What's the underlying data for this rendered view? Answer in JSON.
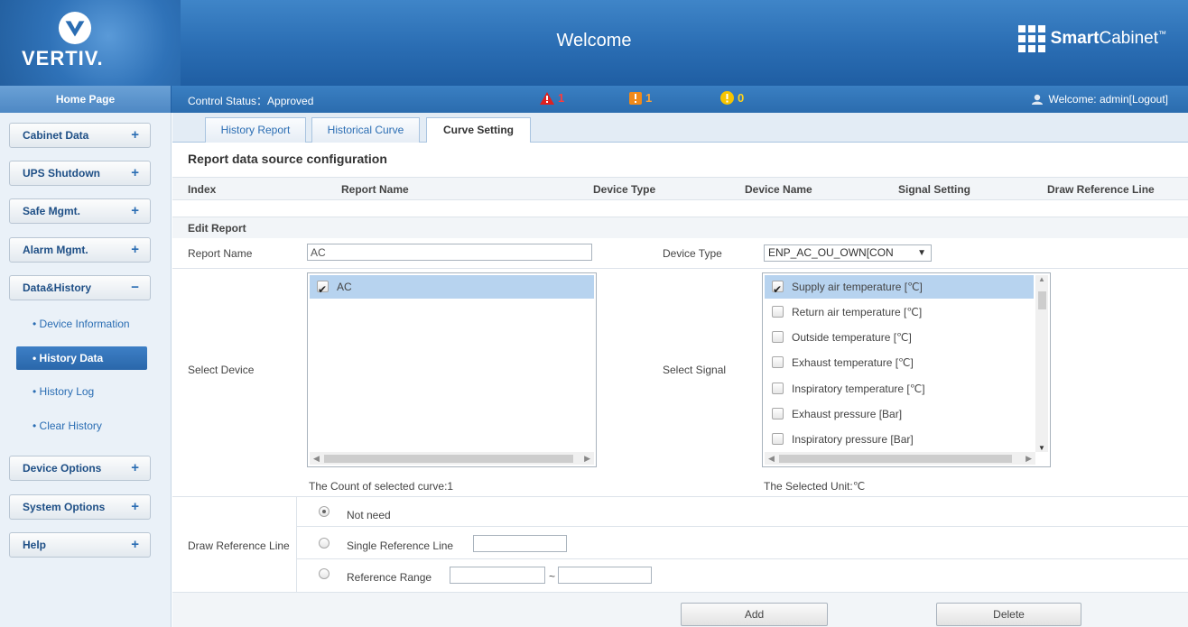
{
  "header": {
    "logo_text": "VERTIV.",
    "title": "Welcome",
    "brand_bold": "Smart",
    "brand_rest": "Cabinet",
    "brand_tm": "™"
  },
  "statusbar": {
    "home": "Home Page",
    "control_status": "Control Status：Approved",
    "alarms": [
      {
        "icon": "critical-alarm-icon",
        "count": "1",
        "color": "#e0201f"
      },
      {
        "icon": "major-alarm-icon",
        "count": "1",
        "color": "#f08a1a"
      },
      {
        "icon": "minor-alarm-icon",
        "count": "0",
        "color": "#f6c400"
      }
    ],
    "welcome": "Welcome: admin[Logout]"
  },
  "sidebar": {
    "menus": [
      {
        "label": "Cabinet Data",
        "sign": "+"
      },
      {
        "label": "UPS Shutdown",
        "sign": "+"
      },
      {
        "label": "Safe Mgmt.",
        "sign": "+"
      },
      {
        "label": "Alarm Mgmt.",
        "sign": "+"
      },
      {
        "label": "Data&History",
        "sign": "−"
      },
      {
        "label": "Device Options",
        "sign": "+"
      },
      {
        "label": "System Options",
        "sign": "+"
      },
      {
        "label": "Help",
        "sign": "+"
      }
    ],
    "sub_items": [
      "• Device Information",
      "• History Data",
      "• History Log",
      "• Clear History"
    ]
  },
  "tabs": [
    "History Report",
    "Historical Curve",
    "Curve Setting"
  ],
  "main": {
    "section_title": "Report data source configuration",
    "columns": [
      "Index",
      "Report Name",
      "Device Type",
      "Device Name",
      "Signal Setting",
      "Draw Reference Line"
    ],
    "edit_title": "Edit Report",
    "report_name_label": "Report Name",
    "report_name_value": "AC",
    "device_type_label": "Device Type",
    "device_type_value": "ENP_AC_OU_OWN[CON",
    "select_device_label": "Select Device",
    "devices": [
      {
        "label": "AC",
        "checked": true
      }
    ],
    "select_signal_label": "Select Signal",
    "signals": [
      {
        "label": "Supply air temperature [℃]",
        "checked": true
      },
      {
        "label": "Return air temperature [℃]",
        "checked": false
      },
      {
        "label": "Outside temperature [℃]",
        "checked": false
      },
      {
        "label": "Exhaust temperature [℃]",
        "checked": false
      },
      {
        "label": "Inspiratory temperature [℃]",
        "checked": false
      },
      {
        "label": "Exhaust pressure [Bar]",
        "checked": false
      },
      {
        "label": "Inspiratory pressure [Bar]",
        "checked": false
      }
    ],
    "count_text": "The Count of selected curve:1",
    "unit_text": "The Selected Unit:℃",
    "draw_ref_label": "Draw Reference Line",
    "ref_options": [
      "Not need",
      "Single Reference Line",
      "Reference Range"
    ],
    "range_sep": "~",
    "add_label": "Add",
    "delete_label": "Delete"
  },
  "colors": {
    "header_blue": "#2a6db3",
    "active_nav": "#2a67aa",
    "selection": "#b7d3ef"
  }
}
